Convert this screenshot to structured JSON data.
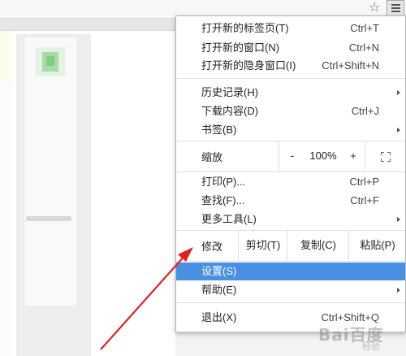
{
  "toolbar": {
    "star_icon": "star-outline-icon",
    "menu_icon": "hamburger-menu-icon"
  },
  "menu": {
    "new_tab": {
      "label": "打开新的标签页(T)",
      "shortcut": "Ctrl+T"
    },
    "new_window": {
      "label": "打开新的窗口(N)",
      "shortcut": "Ctrl+N"
    },
    "new_incognito": {
      "label": "打开新的隐身窗口(I)",
      "shortcut": "Ctrl+Shift+N"
    },
    "history": {
      "label": "历史记录(H)"
    },
    "downloads": {
      "label": "下载内容(D)",
      "shortcut": "Ctrl+J"
    },
    "bookmarks": {
      "label": "书签(B)"
    },
    "zoom": {
      "label": "缩放",
      "minus": "-",
      "value": "100%",
      "plus": "+",
      "fullscreen_icon": "fullscreen-icon"
    },
    "print": {
      "label": "打印(P)...",
      "shortcut": "Ctrl+P"
    },
    "find": {
      "label": "查找(F)...",
      "shortcut": "Ctrl+F"
    },
    "more_tools": {
      "label": "更多工具(L)"
    },
    "edit": {
      "label": "修改",
      "cut": "剪切(T)",
      "copy": "复制(C)",
      "paste": "粘贴(P)"
    },
    "settings": {
      "label": "设置(S)"
    },
    "help": {
      "label": "帮助(E)"
    },
    "exit": {
      "label": "退出(X)",
      "shortcut": "Ctrl+Shift+Q"
    }
  },
  "colors": {
    "highlight": "#4a90e2",
    "arrow": "#e02020"
  },
  "watermark": {
    "text": "Bai百度",
    "subtext": "经验"
  }
}
